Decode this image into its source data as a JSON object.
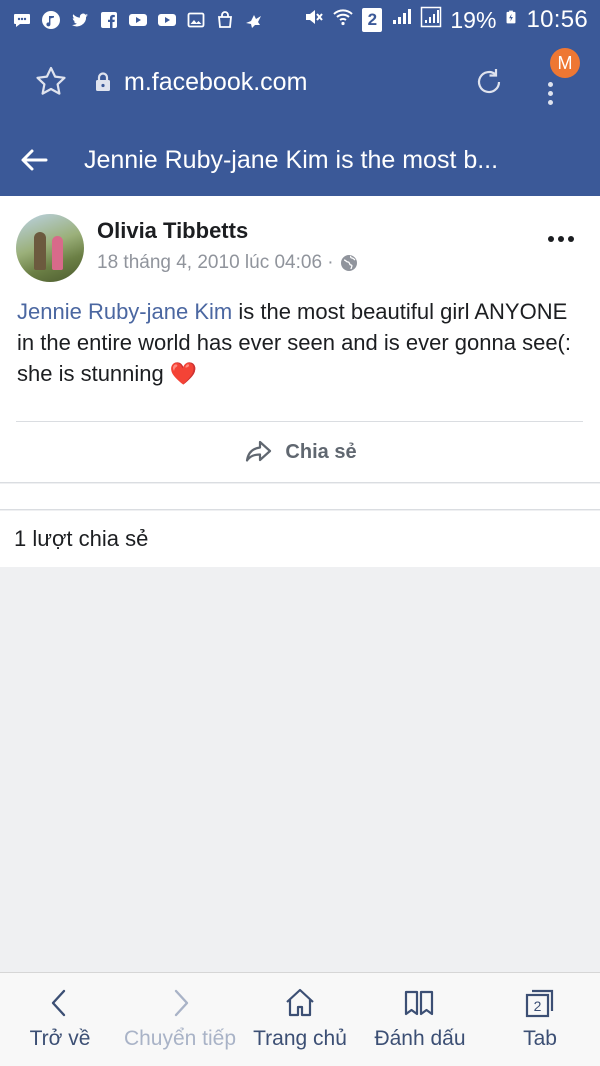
{
  "status_bar": {
    "sim_number": "2",
    "battery_percent": "19%",
    "time": "10:56",
    "icons": [
      "chat-icon",
      "music-icon",
      "twitter-icon",
      "facebook-icon",
      "youtube-icon",
      "youtube-icon",
      "gallery-icon",
      "shopping-bag-icon",
      "bird-icon",
      "mute-icon",
      "wifi-icon",
      "signal-icon",
      "signal-icon",
      "battery-charging-icon"
    ]
  },
  "browser": {
    "url": "m.facebook.com",
    "profile_initial": "M",
    "profile_color": "#ee7733"
  },
  "header": {
    "title": "Jennie Ruby-jane Kim is the most b..."
  },
  "post": {
    "author": "Olivia Tibbetts",
    "timestamp": "18 tháng 4, 2010 lúc 04:06 ·",
    "mention": "Jennie Ruby-jane Kim",
    "body": " is the most beautiful girl ANYONE in the entire world has ever seen and is ever gonna see(: she is stunning ",
    "emoji": "❤️",
    "share_label": "Chia sẻ"
  },
  "share_count": "1 lượt chia sẻ",
  "bottom_nav": {
    "back": "Trở về",
    "forward": "Chuyển tiếp",
    "home": "Trang chủ",
    "bookmarks": "Đánh dấu",
    "tabs": "Tab",
    "tab_count": "2"
  },
  "colors": {
    "facebook_blue": "#3b5998",
    "mention_link": "#4b67a1",
    "heart": "#e0245e"
  }
}
